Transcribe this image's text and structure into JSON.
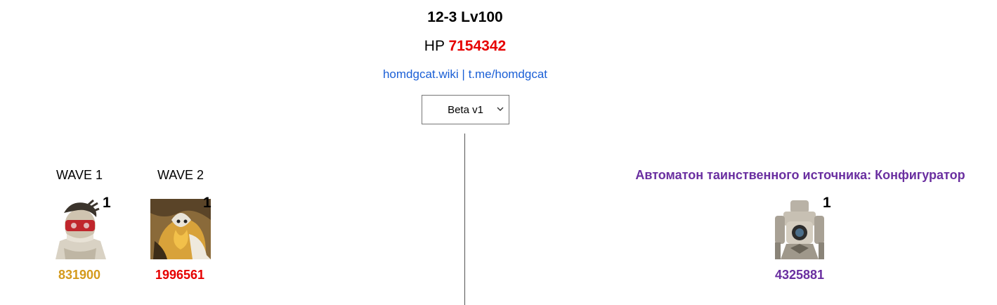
{
  "header": {
    "title": "12-3 Lv100",
    "hp_label": "HP",
    "hp_value": "7154342",
    "link_wiki": "homdgcat.wiki",
    "link_separator": "|",
    "link_telegram": "t.me/homdgcat"
  },
  "version_select": {
    "selected": "Beta v1"
  },
  "waves": [
    {
      "label": "WAVE 1",
      "count": "1",
      "hp": "831900",
      "hp_color": "#d49a1c",
      "icon": "masked-enemy-icon"
    },
    {
      "label": "WAVE 2",
      "count": "1",
      "hp": "1996561",
      "hp_color": "#e60000",
      "icon": "golden-beast-icon"
    }
  ],
  "boss": {
    "name": "Автоматон таинственного источника: Конфигуратор",
    "count": "1",
    "hp": "4325881",
    "hp_color": "#6a2fa0",
    "icon": "automaton-icon"
  }
}
